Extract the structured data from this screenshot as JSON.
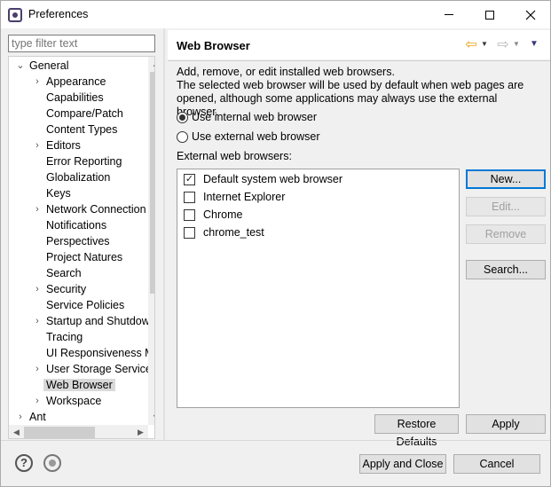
{
  "window": {
    "title": "Preferences"
  },
  "filter": {
    "placeholder": "type filter text"
  },
  "tree": {
    "items": [
      {
        "label": "General",
        "level": 0,
        "twisty": "expanded"
      },
      {
        "label": "Appearance",
        "level": 1,
        "twisty": "collapsed"
      },
      {
        "label": "Capabilities",
        "level": 1,
        "twisty": ""
      },
      {
        "label": "Compare/Patch",
        "level": 1,
        "twisty": ""
      },
      {
        "label": "Content Types",
        "level": 1,
        "twisty": ""
      },
      {
        "label": "Editors",
        "level": 1,
        "twisty": "collapsed"
      },
      {
        "label": "Error Reporting",
        "level": 1,
        "twisty": ""
      },
      {
        "label": "Globalization",
        "level": 1,
        "twisty": ""
      },
      {
        "label": "Keys",
        "level": 1,
        "twisty": ""
      },
      {
        "label": "Network Connection",
        "level": 1,
        "twisty": "collapsed"
      },
      {
        "label": "Notifications",
        "level": 1,
        "twisty": ""
      },
      {
        "label": "Perspectives",
        "level": 1,
        "twisty": ""
      },
      {
        "label": "Project Natures",
        "level": 1,
        "twisty": ""
      },
      {
        "label": "Search",
        "level": 1,
        "twisty": ""
      },
      {
        "label": "Security",
        "level": 1,
        "twisty": "collapsed"
      },
      {
        "label": "Service Policies",
        "level": 1,
        "twisty": ""
      },
      {
        "label": "Startup and Shutdown",
        "level": 1,
        "twisty": "collapsed"
      },
      {
        "label": "Tracing",
        "level": 1,
        "twisty": ""
      },
      {
        "label": "UI Responsiveness Monitoring",
        "level": 1,
        "twisty": ""
      },
      {
        "label": "User Storage Service",
        "level": 1,
        "twisty": "collapsed"
      },
      {
        "label": "Web Browser",
        "level": 1,
        "twisty": "",
        "selected": true
      },
      {
        "label": "Workspace",
        "level": 1,
        "twisty": "collapsed"
      },
      {
        "label": "Ant",
        "level": 0,
        "twisty": "collapsed"
      }
    ]
  },
  "page": {
    "title": "Web Browser",
    "description_line1": "Add, remove, or edit installed web browsers.",
    "description_line2": "The selected web browser will be used by default when web pages are",
    "description_line3": "opened, although some applications may always use the external browser.",
    "radio_internal": "Use internal web browser",
    "radio_external": "Use external web browser",
    "selected_mode": "internal",
    "list_label": "External web browsers:",
    "browsers": [
      {
        "name": "Default system web browser",
        "checked": true
      },
      {
        "name": "Internet Explorer",
        "checked": false
      },
      {
        "name": "Chrome",
        "checked": false
      },
      {
        "name": "chrome_test",
        "checked": false
      }
    ],
    "buttons": {
      "new": "New...",
      "edit": "Edit...",
      "remove": "Remove",
      "search": "Search...",
      "restore_defaults": "Restore Defaults",
      "apply": "Apply"
    }
  },
  "footer": {
    "apply_and_close": "Apply and Close",
    "cancel": "Cancel"
  },
  "icons": {
    "help": "help-icon",
    "record": "record-macro-icon",
    "back": "back-arrow-icon",
    "forward": "forward-arrow-icon"
  },
  "colors": {
    "back_arrow": "#e8a317",
    "default_button_border": "#0078d7",
    "selection": "#d9d9d9"
  }
}
